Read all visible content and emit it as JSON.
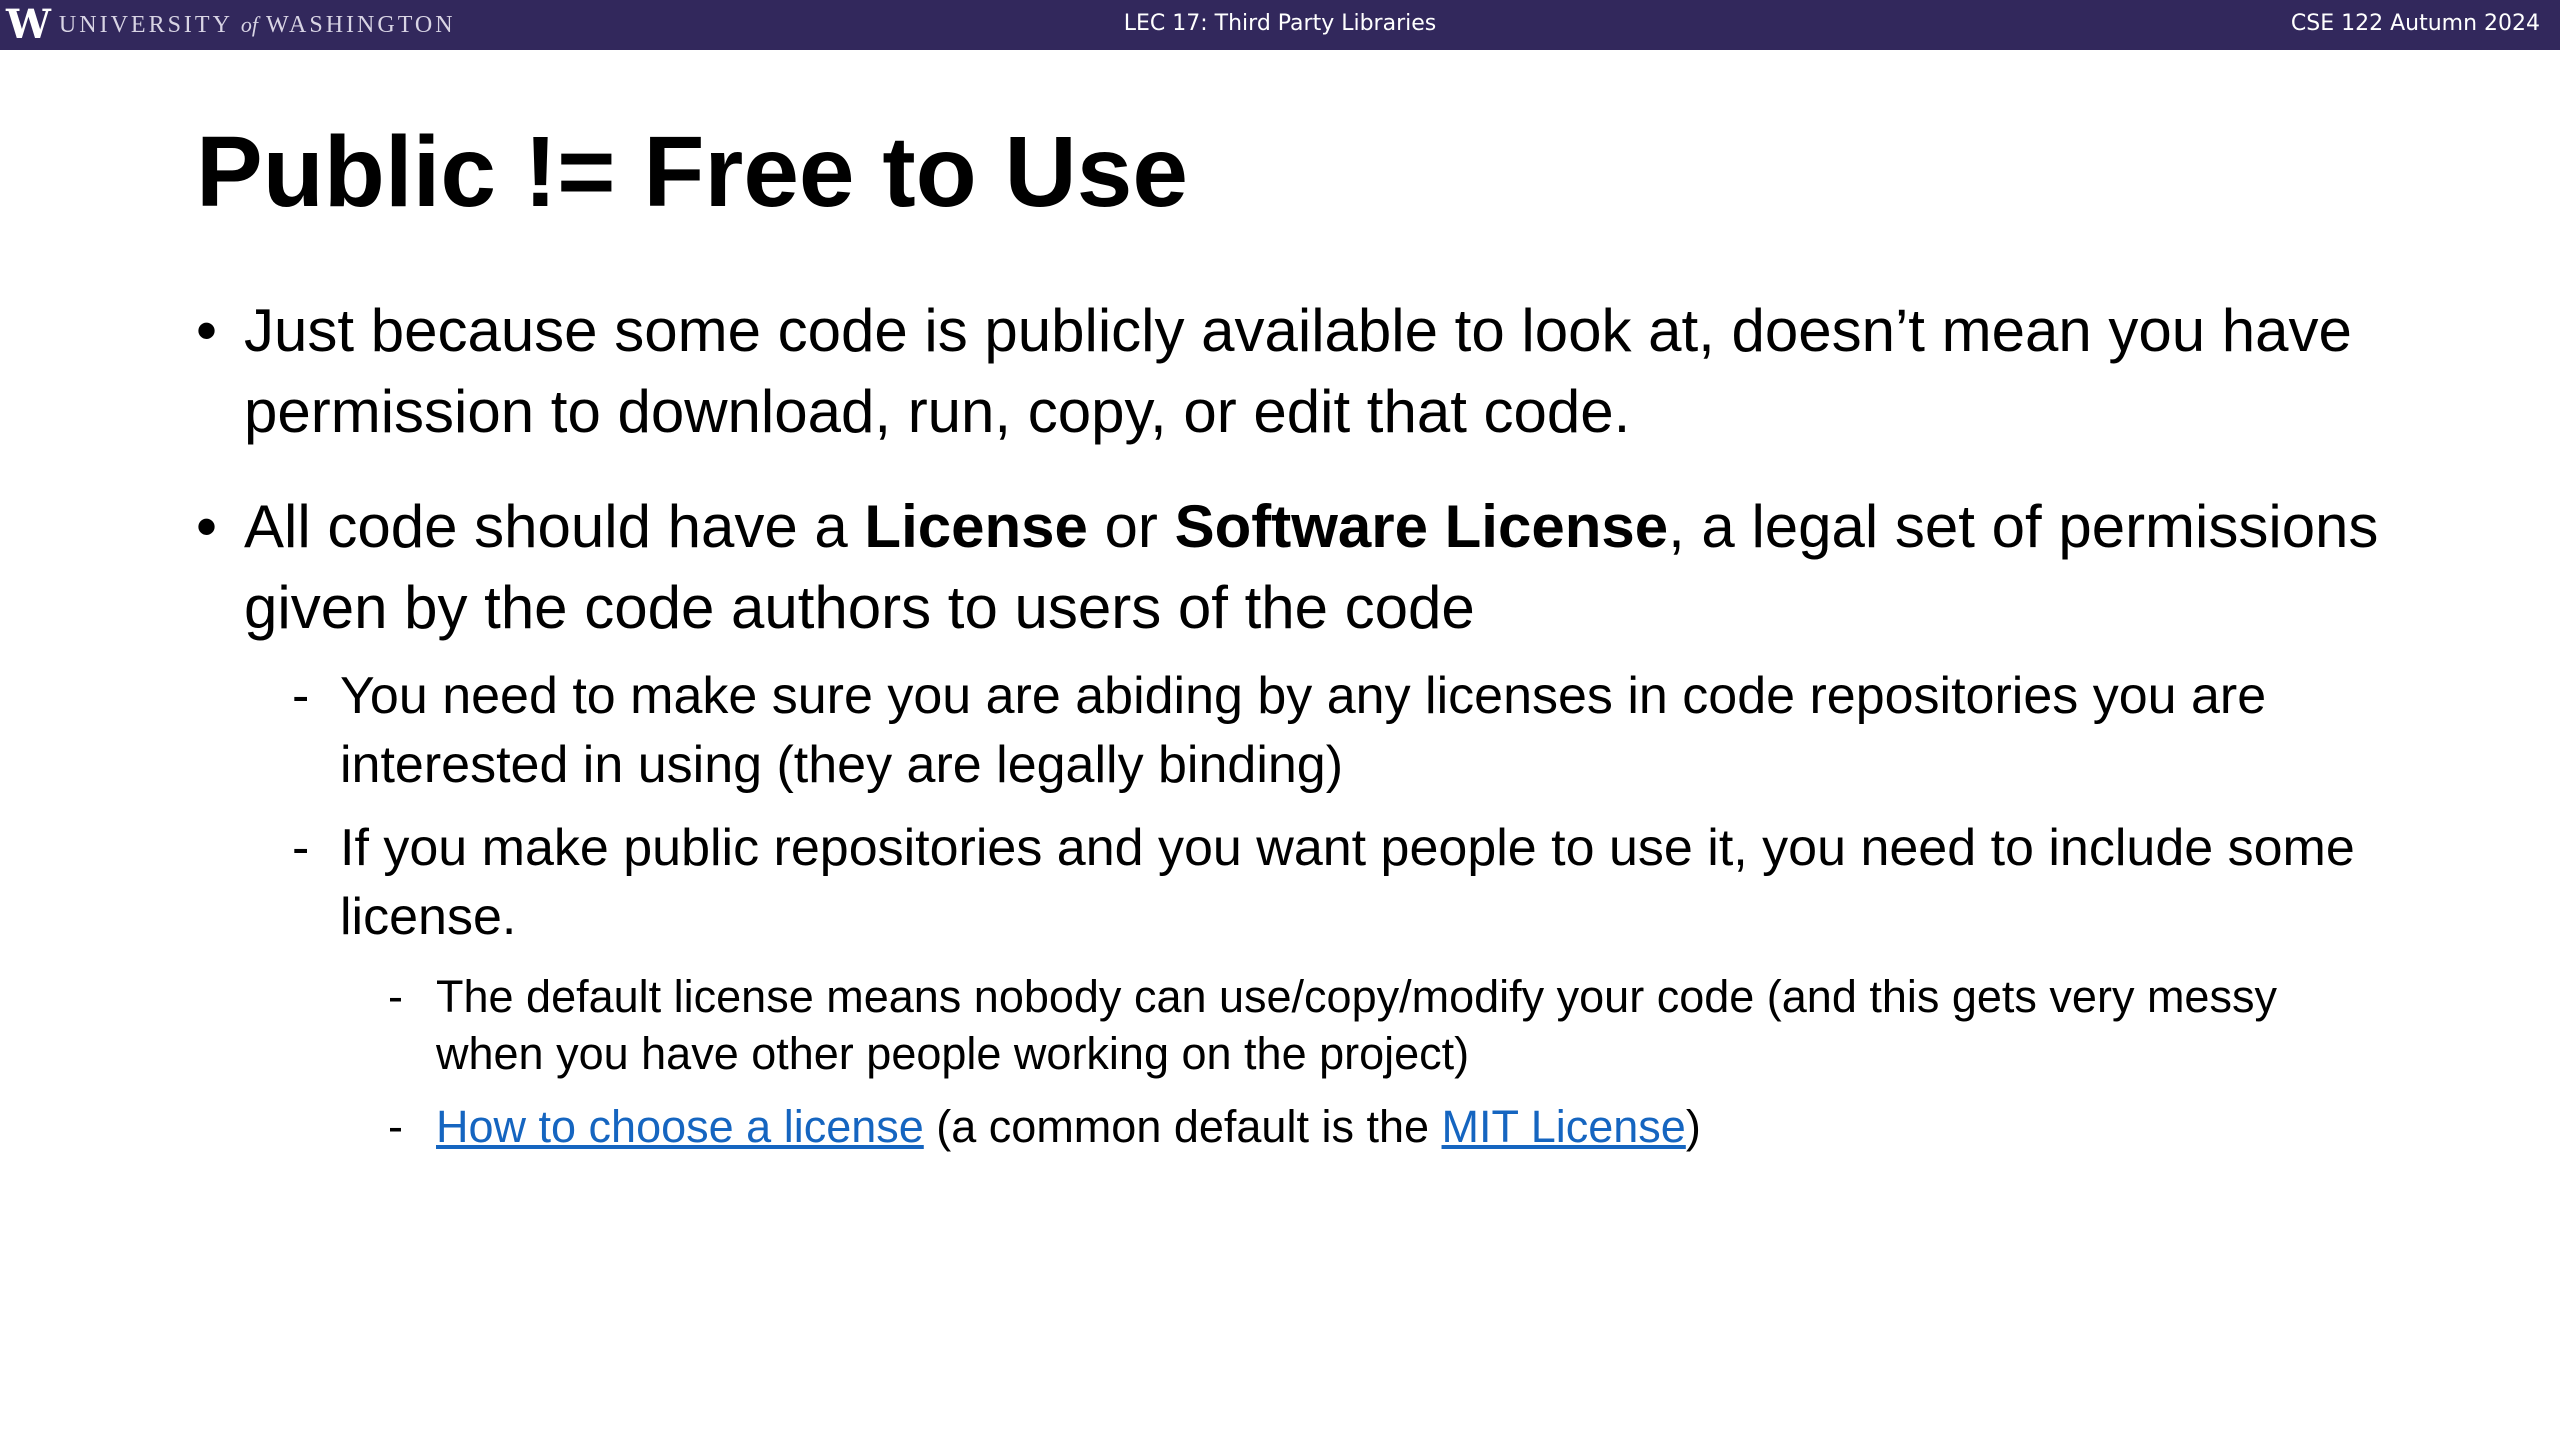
{
  "header": {
    "logo_letter": "W",
    "logo_text_1": "UNIVERSITY",
    "logo_text_of": "of",
    "logo_text_2": "WASHINGTON",
    "lecture_title": "LEC 17: Third Party Libraries",
    "course": "CSE 122 Autumn 2024",
    "bar_color": "#32285c"
  },
  "slide": {
    "title": "Public != Free to Use",
    "bullet_symbol": "•",
    "dash_symbol": "-",
    "bullet_1": "Just because some code is publicly available to look at, doesn’t mean you have permission to download, run, copy, or edit that code.",
    "bullet_2": {
      "part1": "All code should have a ",
      "bold1": "License",
      "part2": " or ",
      "bold2": "Software License",
      "part3": ", a legal set of permissions given by the code authors to users of the code"
    },
    "sub_1": "You need to make sure you are abiding by any licenses in code repositories you are interested in using (they are legally binding)",
    "sub_2": "If you make public repositories and you want people to use it, you need to include some license.",
    "subsub_1": "The default license means nobody can use/copy/modify your code (and this gets very messy when you have other people working on the project)",
    "subsub_2": {
      "link1": "How to choose a license",
      "mid": " (a common default is the ",
      "link2": "MIT License",
      "end": ")"
    },
    "link_color": "#1565c0"
  }
}
